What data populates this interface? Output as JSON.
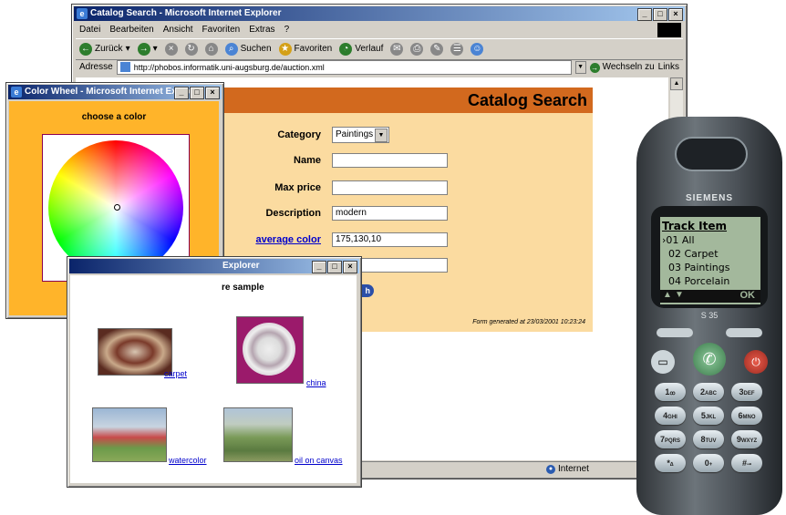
{
  "browser": {
    "title": "Catalog Search - Microsoft Internet Explorer",
    "menu": [
      "Datei",
      "Bearbeiten",
      "Ansicht",
      "Favoriten",
      "Extras",
      "?"
    ],
    "toolbar": {
      "back": "Zurück",
      "search": "Suchen",
      "favorites": "Favoriten",
      "history": "Verlauf"
    },
    "address_label": "Adresse",
    "address_url": "http://phobos.informatik.uni-augsburg.de/auction.xml",
    "go_label": "Wechseln zu",
    "links_label": "Links",
    "status_zone": "Internet"
  },
  "catalog": {
    "header": "Catalog Search",
    "category_label": "Category",
    "category_value": "Paintings",
    "name_label": "Name",
    "name_value": "",
    "maxprice_label": "Max price",
    "maxprice_value": "",
    "description_label": "Description",
    "description_value": "modern",
    "avgcolor_label": "average color",
    "avgcolor_value": "175,130,10",
    "extra_value": "",
    "button_tail": "h",
    "footer": "Form generated at 23/03/2001 10:23:24"
  },
  "colorwheel": {
    "title": "Color Wheel - Microsoft Internet Explorer",
    "prompt": "choose a color"
  },
  "texture": {
    "title": "Explorer",
    "heading": "re sample",
    "items": [
      {
        "label": "carpet"
      },
      {
        "label": "china"
      },
      {
        "label": "watercolor"
      },
      {
        "label": "oil on canvas"
      }
    ]
  },
  "phone": {
    "brand": "SIEMENS",
    "model": "S 35",
    "screen_title": "Track Item",
    "menu": [
      "01 All",
      "02 Carpet",
      "03 Paintings",
      "04 Porcelain"
    ],
    "ok_label": "OK",
    "keys": [
      [
        "1",
        "ꝏ"
      ],
      [
        "2",
        "ABC"
      ],
      [
        "3",
        "DEF"
      ],
      [
        "4",
        "GHI"
      ],
      [
        "5",
        "JKL"
      ],
      [
        "6",
        "MNO"
      ],
      [
        "7",
        "PQRS"
      ],
      [
        "8",
        "TUV"
      ],
      [
        "9",
        "WXYZ"
      ],
      [
        "*",
        "∆"
      ],
      [
        "0",
        "+"
      ],
      [
        "#",
        "⊸"
      ]
    ]
  }
}
